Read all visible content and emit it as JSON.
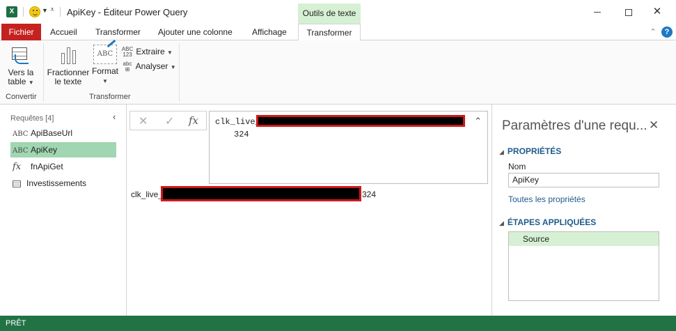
{
  "titlebar": {
    "app_icon": "excel-icon",
    "title": "ApiKey - Éditeur Power Query",
    "context_tab_group": "Outils de texte"
  },
  "ribbon_tabs": {
    "fichier": "Fichier",
    "accueil": "Accueil",
    "transformer": "Transformer",
    "ajouter_colonne": "Ajouter une colonne",
    "affichage": "Affichage",
    "transformer_contextual": "Transformer",
    "help": "?"
  },
  "ribbon": {
    "vers_table_line1": "Vers la",
    "vers_table_line2": "table",
    "group_convertir": "Convertir",
    "fractionner_line1": "Fractionner",
    "fractionner_line2": "le texte",
    "format": "Format",
    "extraire": "Extraire",
    "extraire_badge_top": "ABC",
    "extraire_badge_bottom": "123",
    "analyser": "Analyser",
    "analyser_badge": "abc",
    "format_badge": "ABC",
    "group_transformer": "Transformer"
  },
  "queries": {
    "header": "Requêtes [4]",
    "items": [
      {
        "label": "ApiBaseUrl",
        "icon": "text-type-icon",
        "glyph": "ABC"
      },
      {
        "label": "ApiKey",
        "icon": "text-type-icon",
        "glyph": "ABC",
        "selected": true
      },
      {
        "label": "fnApiGet",
        "icon": "function-icon",
        "glyph": "fx"
      },
      {
        "label": "Investissements",
        "icon": "table-icon",
        "glyph": ""
      }
    ]
  },
  "formula": {
    "fx": "fx",
    "line1_prefix": "clk_live_",
    "line2": "324"
  },
  "result": {
    "prefix": "clk_live_",
    "suffix": "324"
  },
  "settings": {
    "title": "Paramètres d'une requ...",
    "properties_header": "PROPRIÉTÉS",
    "name_label": "Nom",
    "name_value": "ApiKey",
    "all_properties_link": "Toutes les propriétés",
    "steps_header": "ÉTAPES APPLIQUÉES",
    "steps": [
      "Source"
    ]
  },
  "status": {
    "text": "PRÊT"
  }
}
